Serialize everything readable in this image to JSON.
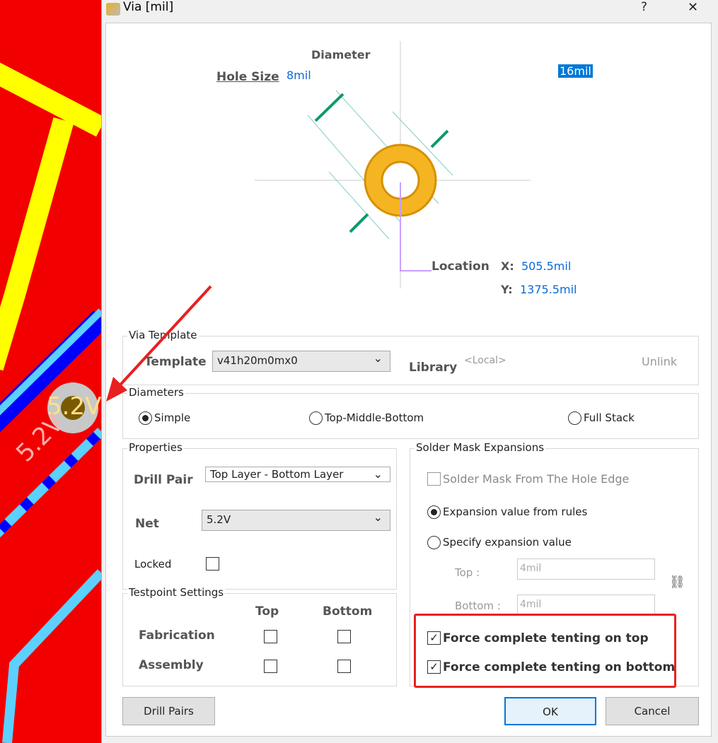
{
  "pcb": {
    "net_label": "5.2V",
    "via_label": "5.2V"
  },
  "window": {
    "title": "Via [mil]",
    "help": "?",
    "close": "✕"
  },
  "diagram": {
    "diameter_label": "Diameter",
    "hole_size_label": "Hole Size",
    "hole_size": "8mil",
    "diameter": "16mil",
    "location_label": "Location",
    "x_label": "X:",
    "x": "505.5mil",
    "y_label": "Y:",
    "y": "1375.5mil"
  },
  "via_template": {
    "legend": "Via Template",
    "template_label": "Template",
    "template": "v41h20m0mx0",
    "library_label": "Library",
    "library": "<Local>",
    "unlink": "Unlink"
  },
  "diameters": {
    "legend": "Diameters",
    "options": [
      "Simple",
      "Top-Middle-Bottom",
      "Full Stack"
    ],
    "selected": "Simple"
  },
  "properties": {
    "legend": "Properties",
    "drill_pair_label": "Drill Pair",
    "drill_pair": "Top Layer - Bottom Layer",
    "net_label": "Net",
    "net": "5.2V",
    "locked_label": "Locked",
    "locked": false
  },
  "testpoint": {
    "legend": "Testpoint Settings",
    "col_top": "Top",
    "col_bottom": "Bottom",
    "rows": [
      {
        "label": "Fabrication",
        "top": false,
        "bottom": false
      },
      {
        "label": "Assembly",
        "top": false,
        "bottom": false
      }
    ]
  },
  "solder_mask": {
    "legend": "Solder Mask Expansions",
    "from_hole_edge": "Solder Mask From The Hole Edge",
    "from_rules": "Expansion value from rules",
    "specify": "Specify expansion value",
    "top_label": "Top :",
    "top": "4mil",
    "bottom_label": "Bottom :",
    "bottom": "4mil",
    "tent_top": "Force complete tenting on top",
    "tent_bottom": "Force complete tenting on bottom",
    "tent_top_checked": true,
    "tent_bottom_checked": true
  },
  "buttons": {
    "drill_pairs": "Drill Pairs",
    "ok": "OK",
    "cancel": "Cancel"
  },
  "colors": {
    "annotation": "#e82020",
    "via_ring": "#f5b522",
    "arrow": "#0b9a6a",
    "value": "#0a6ad8"
  }
}
